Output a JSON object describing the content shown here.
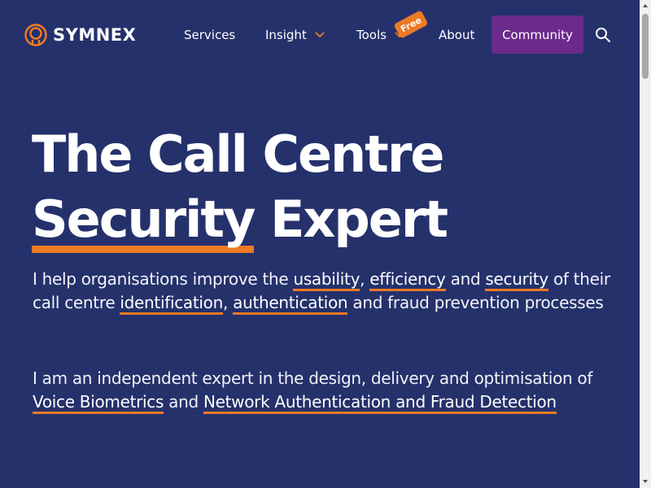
{
  "brand": {
    "name": "SYMNEX",
    "accent": "#ec7a25",
    "background": "#25316b",
    "community_bg": "#6b2a8c"
  },
  "nav": {
    "services": "Services",
    "insight": "Insight",
    "tools": "Tools",
    "tools_badge": "Free",
    "about": "About",
    "community": "Community",
    "search_icon": "search-icon"
  },
  "hero": {
    "title_line1": "The Call Centre",
    "title_highlight": "Security",
    "title_rest": " Expert"
  },
  "intro": {
    "p1_a": "I help organisations improve the ",
    "link_usability": "usability",
    "p1_b": ", ",
    "link_efficiency": "efficiency",
    "p1_c": " and ",
    "link_security": "security",
    "p1_d": " of their call centre ",
    "link_identification": "identification",
    "p1_e": ", ",
    "link_authentication": "authentication",
    "p1_f": " and fraud prevention processes",
    "p2_a": "I am an independent expert in the design, delivery and optimisation of ",
    "link_voice_biometrics": "Voice Biometrics",
    "p2_b": " and ",
    "link_network_auth": "Network Authentication and Fraud Detection"
  }
}
